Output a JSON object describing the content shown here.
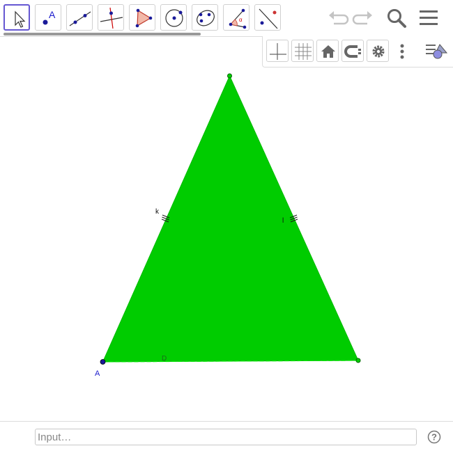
{
  "toolbar": {
    "tools": [
      {
        "name": "move-tool",
        "selected": true
      },
      {
        "name": "point-tool"
      },
      {
        "name": "line-tool"
      },
      {
        "name": "perpendicular-line-tool"
      },
      {
        "name": "polygon-tool"
      },
      {
        "name": "circle-tool"
      },
      {
        "name": "conic-tool"
      },
      {
        "name": "angle-tool"
      },
      {
        "name": "reflect-tool"
      }
    ],
    "icons": [
      "undo-icon",
      "redo-icon",
      "search-icon",
      "menu-icon"
    ]
  },
  "graphics_style_bar": {
    "icons": [
      "axes-icon",
      "grid-icon",
      "home-icon",
      "point-capturing-icon",
      "settings-icon",
      "more-icon",
      "style-bar-toggle-icon"
    ]
  },
  "figure": {
    "fill_color": "#00cc00",
    "point_color": "#1a1a99",
    "labels": {
      "point_a": "A",
      "segment_k": "k",
      "segment_l": "l",
      "segment_d": "D"
    }
  },
  "input_bar": {
    "placeholder": "Input…"
  }
}
